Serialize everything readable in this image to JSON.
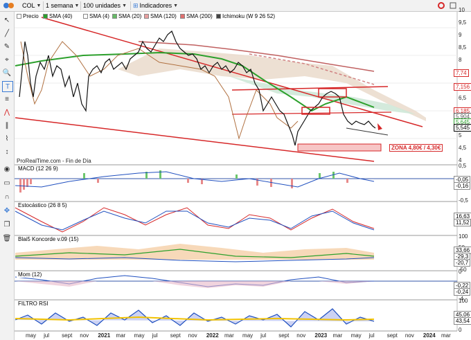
{
  "toolbar": {
    "symbol": "COL",
    "period": "1 semana",
    "units": "100 unidades",
    "indicators": "Indicadores",
    "legend": [
      {
        "label": "Precio",
        "color": "#ffffff"
      },
      {
        "label": "SMA (40)",
        "color": "#2ca02c"
      },
      {
        "label": "SMA (4)",
        "color": "#ffffff"
      },
      {
        "label": "SMA (20)",
        "color": "#66bb66"
      },
      {
        "label": "SMA (120)",
        "color": "#e8a0a0"
      },
      {
        "label": "SMA (200)",
        "color": "#e07070"
      },
      {
        "label": "Ichimoku (W 9 26 52)",
        "color": "#444444"
      }
    ]
  },
  "chart": {
    "source_label": "ProRealTime.com - Fin de Día",
    "zone_label": "ZONA 4,80€ / 4,30€",
    "price_axis": [
      "10",
      "9,5",
      "9",
      "8,5",
      "8",
      "7,5",
      "7",
      "6,5",
      "6",
      "5,5",
      "5",
      "4,5",
      "4"
    ],
    "price_tags": [
      {
        "text": "7,74",
        "color": "#d62728"
      },
      {
        "text": "7,156",
        "color": "#d62728"
      },
      {
        "text": "6,185",
        "color": "#d62728"
      },
      {
        "text": "5,904",
        "color": "#555555"
      },
      {
        "text": "5,645",
        "color": "#2ca02c"
      },
      {
        "text": "5,545",
        "color": "#000000"
      }
    ],
    "x_axis": [
      "may",
      "jul",
      "sept",
      "nov",
      "2021",
      "mar",
      "may",
      "jul",
      "sept",
      "nov",
      "2022",
      "mar",
      "may",
      "jul",
      "sept",
      "nov",
      "2023",
      "mar",
      "may",
      "jul",
      "sept",
      "nov",
      "2024",
      "mar"
    ]
  },
  "panels": [
    {
      "title": "MACD (12 26 9)",
      "axis": [
        "0,5",
        "0",
        "-0,5"
      ],
      "tags": [
        "-0,05",
        "-0,16"
      ]
    },
    {
      "title": "Estocástico (26 8 5)",
      "axis": [],
      "tags": [
        "16,63",
        "11,52"
      ]
    },
    {
      "title": "Blai5 Koncorde v.09 (15)",
      "axis": [
        "100",
        "50",
        "0",
        "-50"
      ],
      "tags": [
        "33,66",
        "-29,3",
        "-20,7"
      ]
    },
    {
      "title": "Mom (12)",
      "axis": [
        "0",
        "-2",
        "-4"
      ],
      "tags": [
        "-0,22",
        "-0,24"
      ]
    },
    {
      "title": "FILTRO RSI",
      "axis": [
        "100",
        "50",
        "0"
      ],
      "tags": [
        "45,06",
        "43,54"
      ]
    }
  ]
}
